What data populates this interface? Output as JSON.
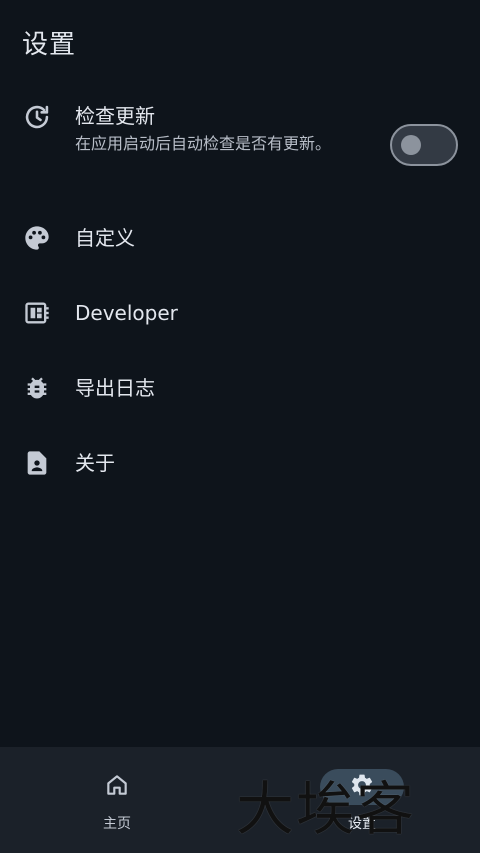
{
  "header": {
    "title": "设置"
  },
  "settings": {
    "check_update": {
      "title": "检查更新",
      "subtitle": "在应用启动后自动检查是否有更新。",
      "enabled": false,
      "icon": "update-clock-icon"
    },
    "customize": {
      "title": "自定义",
      "icon": "palette-icon"
    },
    "developer": {
      "title": "Developer",
      "icon": "developer-board-icon"
    },
    "export_log": {
      "title": "导出日志",
      "icon": "bug-icon"
    },
    "about": {
      "title": "关于",
      "icon": "contact-document-icon"
    }
  },
  "bottom_nav": {
    "items": [
      {
        "label": "主页",
        "icon": "home-icon",
        "selected": false
      },
      {
        "label": "设置",
        "icon": "gear-icon",
        "selected": true
      }
    ]
  },
  "watermark": {
    "text": "大埃客"
  },
  "colors": {
    "background": "#0e141b",
    "nav_background": "#1b2129",
    "selected_pill": "#3a4c5c",
    "text_primary": "#e3e7ee",
    "text_secondary": "#b8bec8"
  }
}
